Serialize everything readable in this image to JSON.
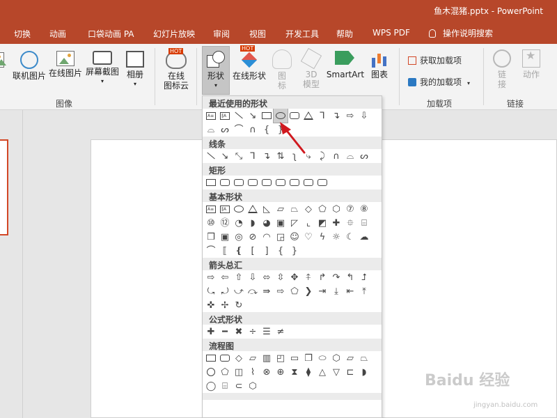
{
  "window": {
    "document_title": "鱼木混猪.pptx  -  PowerPoint"
  },
  "ribbon_tabs": [
    {
      "label": "切换"
    },
    {
      "label": "动画"
    },
    {
      "label": "口袋动画 PA"
    },
    {
      "label": "幻灯片放映"
    },
    {
      "label": "审阅"
    },
    {
      "label": "视图"
    },
    {
      "label": "开发工具"
    },
    {
      "label": "帮助"
    },
    {
      "label": "WPS PDF"
    }
  ],
  "tell_me": {
    "label": "操作说明搜索",
    "icon": "lightbulb-icon"
  },
  "ribbon": {
    "image_group": {
      "label": "图像",
      "buttons": [
        {
          "label": "联机图片",
          "icon": "online-picture-icon"
        },
        {
          "label": "在线图片",
          "icon": "web-picture-icon"
        },
        {
          "label": "屏幕截图",
          "icon": "screenshot-icon"
        },
        {
          "label": "相册",
          "icon": "photo-album-icon"
        }
      ]
    },
    "cloud_button": {
      "label_line1": "在线",
      "label_line2": "图标云",
      "badge": "HOT"
    },
    "illustrations": {
      "shapes": {
        "label": "形状",
        "state": "expanded"
      },
      "online_shapes": {
        "label": "在线形状",
        "badge": "HOT"
      },
      "icons": {
        "label_line1": "图",
        "label_line2": "标"
      },
      "model3d": {
        "label_line1": "3D",
        "label_line2": "模型"
      },
      "smartart": {
        "label": "SmartArt"
      },
      "chart": {
        "label": "图表"
      }
    },
    "addins_group": {
      "label": "加载项",
      "get_addins": "获取加载项",
      "my_addins": "我的加载项"
    },
    "links_group": {
      "label": "链接",
      "link": {
        "label_line1": "链",
        "label_line2": "接"
      },
      "action": {
        "label": "动作"
      }
    }
  },
  "shapes_gallery": {
    "categories": [
      {
        "name": "最近使用的形状"
      },
      {
        "name": "线条"
      },
      {
        "name": "矩形"
      },
      {
        "name": "基本形状"
      },
      {
        "name": "箭头总汇"
      },
      {
        "name": "公式形状"
      },
      {
        "name": "流程图"
      }
    ],
    "selected_shape": "oval"
  },
  "watermark": {
    "brand": "Baidu 经验",
    "url": "jingyan.baidu.com"
  },
  "colors": {
    "accent": "#b7472a",
    "ribbon_bg": "#f3f3f3",
    "selection": "#d24726",
    "arrow": "#d0191f"
  }
}
